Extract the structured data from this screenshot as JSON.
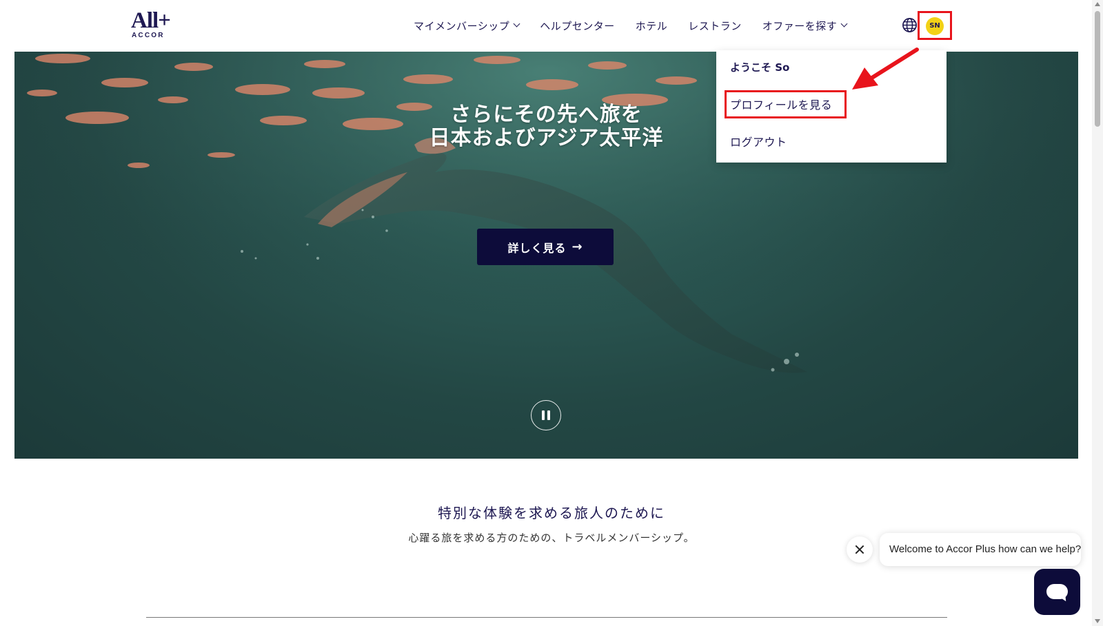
{
  "header": {
    "logo_main": "All+",
    "logo_sub": "ACCOR",
    "nav": [
      {
        "label": "マイメンバーシップ",
        "has_dropdown": true
      },
      {
        "label": "ヘルプセンター",
        "has_dropdown": false
      },
      {
        "label": "ホテル",
        "has_dropdown": false
      },
      {
        "label": "レストラン",
        "has_dropdown": false
      },
      {
        "label": "オファーを探す",
        "has_dropdown": true
      }
    ],
    "language_icon": "globe-icon",
    "avatar_initials": "SN"
  },
  "user_menu": {
    "welcome": "ようこそ So",
    "items": [
      {
        "label": "プロフィールを見る"
      },
      {
        "label": "ログアウト"
      }
    ]
  },
  "hero": {
    "title_line1": "さらにその先へ旅を",
    "title_line2": "日本およびアジア太平洋",
    "cta_label": "詳しく見る",
    "cta_icon": "arrow-right-icon",
    "pause_icon": "pause-icon"
  },
  "intro": {
    "title": "特別な体験を求める旅人のために",
    "subtitle": "心躍る旅を求める方のための、トラベルメンバーシップ。"
  },
  "chat": {
    "message": "Welcome to Accor Plus how can we help?",
    "close_icon": "close-icon",
    "launcher_icon": "chat-icon"
  },
  "colors": {
    "brand_navy": "#1e1852",
    "cta_navy": "#0d0c3a",
    "avatar_yellow": "#f3d116",
    "highlight_red": "#e8141c"
  }
}
